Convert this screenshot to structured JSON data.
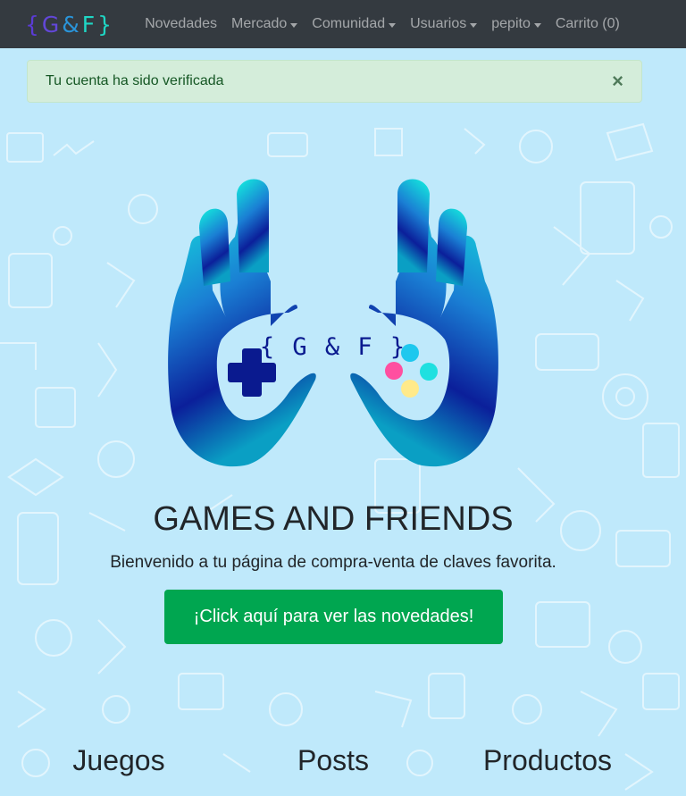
{
  "navbar": {
    "brand": {
      "open": "{",
      "g": "G",
      "amp": "&",
      "f": "F",
      "close": "}"
    },
    "items": [
      {
        "label": "Novedades",
        "dropdown": false
      },
      {
        "label": "Mercado",
        "dropdown": true
      },
      {
        "label": "Comunidad",
        "dropdown": true
      },
      {
        "label": "Usuarios",
        "dropdown": true
      },
      {
        "label": "pepito",
        "dropdown": true
      },
      {
        "label": "Carrito (0)",
        "dropdown": false
      }
    ]
  },
  "alert": {
    "message": "Tu cuenta ha sido verificada",
    "close_symbol": "×"
  },
  "logo": {
    "text": "{ G & F }"
  },
  "hero": {
    "title": "GAMES AND FRIENDS",
    "subtitle": "Bienvenido a tu página de compra-venta de claves favorita.",
    "cta_label": "¡Click aquí para ver las novedades!"
  },
  "sections": {
    "juegos": "Juegos",
    "posts": "Posts",
    "productos": "Productos"
  },
  "colors": {
    "navbar_bg": "#343a40",
    "page_bg": "#bfe9fb",
    "alert_bg": "#d4edda",
    "cta_bg": "#00a650",
    "logo_dark": "#0a1a8f",
    "logo_light": "#14f0e0"
  }
}
